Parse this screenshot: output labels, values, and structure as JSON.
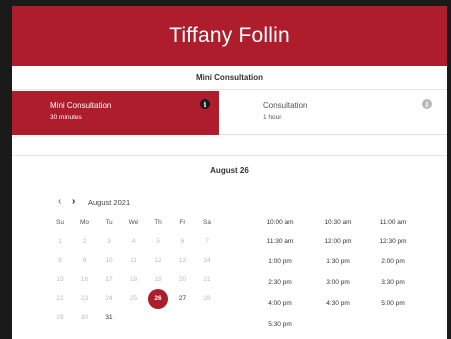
{
  "header": {
    "title": "Tiffany Follin"
  },
  "service": {
    "title": "Mini Consultation"
  },
  "options": [
    {
      "name": "Mini Consultation",
      "duration": "30 minutes",
      "info": "i"
    },
    {
      "name": "Consultation",
      "duration": "1 hour",
      "info": "i"
    }
  ],
  "date_heading": "August 26",
  "calendar": {
    "prev": "‹",
    "next": "›",
    "month": "August 2021",
    "dow": [
      "Su",
      "Mo",
      "Tu",
      "We",
      "Th",
      "Fr",
      "Sa"
    ],
    "weeks": [
      [
        "1",
        "2",
        "3",
        "4",
        "5",
        "6",
        "7"
      ],
      [
        "8",
        "9",
        "10",
        "11",
        "12",
        "13",
        "14"
      ],
      [
        "15",
        "16",
        "17",
        "18",
        "19",
        "20",
        "21"
      ],
      [
        "22",
        "23",
        "24",
        "25",
        "26",
        "27",
        "28"
      ],
      [
        "29",
        "30",
        "31"
      ]
    ],
    "selected": "26",
    "available": [
      "27",
      "31"
    ]
  },
  "slots": [
    [
      "10:00 am",
      "10:30 am",
      "11:00 am"
    ],
    [
      "11:30 am",
      "12:00 pm",
      "12:30 pm"
    ],
    [
      "1:00 pm",
      "1:30 pm",
      "2:00 pm"
    ],
    [
      "2:30 pm",
      "3:00 pm",
      "3:30 pm"
    ],
    [
      "4:00 pm",
      "4:30 pm",
      "5:00 pm"
    ],
    [
      "5:30 pm"
    ]
  ],
  "colors": {
    "accent": "#ad1d2c",
    "frame": "#1a1a1a"
  }
}
